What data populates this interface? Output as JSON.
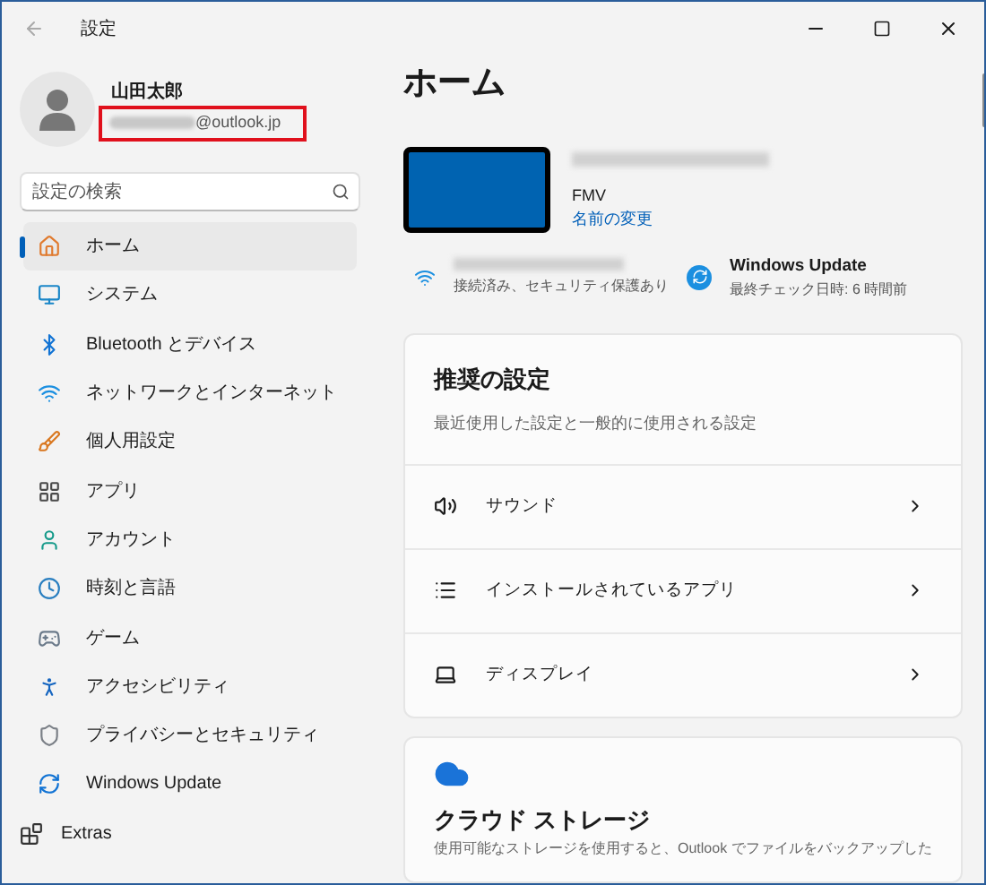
{
  "window": {
    "title": "設定"
  },
  "profile": {
    "name": "山田太郎",
    "email_domain": "@outlook.jp"
  },
  "search": {
    "placeholder": "設定の検索"
  },
  "sidebar": {
    "items": [
      {
        "label": "ホーム",
        "selected": true
      },
      {
        "label": "システム",
        "selected": false
      },
      {
        "label": "Bluetooth とデバイス",
        "selected": false
      },
      {
        "label": "ネットワークとインターネット",
        "selected": false
      },
      {
        "label": "個人用設定",
        "selected": false
      },
      {
        "label": "アプリ",
        "selected": false
      },
      {
        "label": "アカウント",
        "selected": false
      },
      {
        "label": "時刻と言語",
        "selected": false
      },
      {
        "label": "ゲーム",
        "selected": false
      },
      {
        "label": "アクセシビリティ",
        "selected": false
      },
      {
        "label": "プライバシーとセキュリティ",
        "selected": false
      },
      {
        "label": "Windows Update",
        "selected": false
      },
      {
        "label": "Extras",
        "selected": false
      }
    ]
  },
  "page": {
    "title": "ホーム",
    "device": {
      "model": "FMV",
      "rename_link": "名前の変更"
    },
    "network": {
      "status": "接続済み、セキュリティ保護あり"
    },
    "update": {
      "title": "Windows Update",
      "status": "最終チェック日時: 6 時間前"
    },
    "recommended": {
      "title": "推奨の設定",
      "subtitle": "最近使用した設定と一般的に使用される設定",
      "rows": [
        {
          "label": "サウンド"
        },
        {
          "label": "インストールされているアプリ"
        },
        {
          "label": "ディスプレイ"
        }
      ]
    },
    "cloud": {
      "title": "クラウド ストレージ",
      "text": "使用可能なストレージを使用すると、Outlook でファイルをバックアップした"
    }
  }
}
